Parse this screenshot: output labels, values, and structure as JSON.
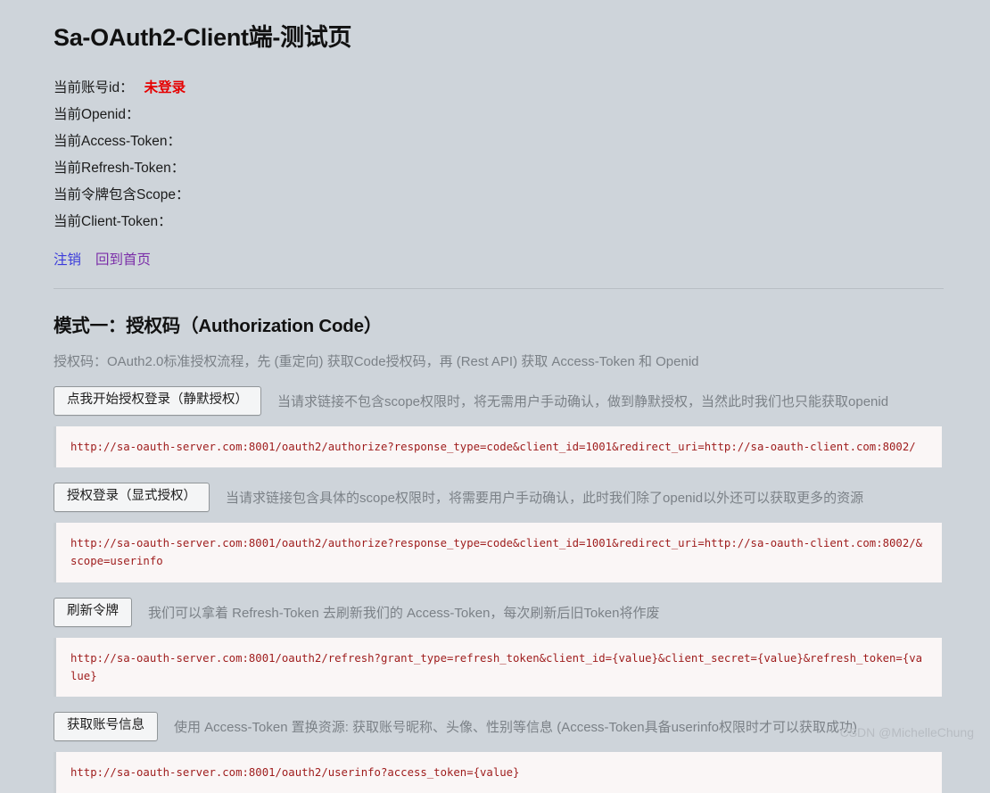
{
  "page": {
    "title": "Sa-OAuth2-Client端-测试页"
  },
  "account_info": {
    "rows": [
      {
        "label": "当前账号id：",
        "value": "未登录",
        "highlight": true
      },
      {
        "label": "当前Openid：",
        "value": "",
        "highlight": false
      },
      {
        "label": "当前Access-Token：",
        "value": "",
        "highlight": false
      },
      {
        "label": "当前Refresh-Token：",
        "value": "",
        "highlight": false
      },
      {
        "label": "当前令牌包含Scope：",
        "value": "",
        "highlight": false
      },
      {
        "label": "当前Client-Token：",
        "value": "",
        "highlight": false
      }
    ]
  },
  "links": {
    "logout": "注销",
    "home": "回到首页"
  },
  "section": {
    "heading": "模式一：授权码（Authorization Code）",
    "description": "授权码：OAuth2.0标准授权流程，先 (重定向) 获取Code授权码，再 (Rest API) 获取 Access-Token 和 Openid"
  },
  "actions": [
    {
      "button_label": "点我开始授权登录（静默授权）",
      "note": "当请求链接不包含scope权限时，将无需用户手动确认，做到静默授权，当然此时我们也只能获取openid",
      "url": "http://sa-oauth-server.com:8001/oauth2/authorize?response_type=code&client_id=1001&redirect_uri=http://sa-oauth-client.com:8002/"
    },
    {
      "button_label": "授权登录（显式授权）",
      "note": "当请求链接包含具体的scope权限时，将需要用户手动确认，此时我们除了openid以外还可以获取更多的资源",
      "url": "http://sa-oauth-server.com:8001/oauth2/authorize?response_type=code&client_id=1001&redirect_uri=http://sa-oauth-client.com:8002/&scope=userinfo"
    },
    {
      "button_label": "刷新令牌",
      "note": "我们可以拿着 Refresh-Token 去刷新我们的 Access-Token，每次刷新后旧Token将作废",
      "url": "http://sa-oauth-server.com:8001/oauth2/refresh?grant_type=refresh_token&client_id={value}&client_secret={value}&refresh_token={value}"
    },
    {
      "button_label": "获取账号信息",
      "note": "使用 Access-Token 置换资源: 获取账号昵称、头像、性别等信息 (Access-Token具备userinfo权限时才可以获取成功)",
      "url": "http://sa-oauth-server.com:8001/oauth2/userinfo?access_token={value}"
    }
  ],
  "watermark": {
    "text": "CSDN @MichelleChung"
  },
  "colors": {
    "background": "#ced4da",
    "danger": "#e60000",
    "link_unvisited": "#3b3bdb",
    "link_visited": "#7b2ea8",
    "code_text": "#9e1b1b",
    "muted_text": "#7b8187"
  }
}
